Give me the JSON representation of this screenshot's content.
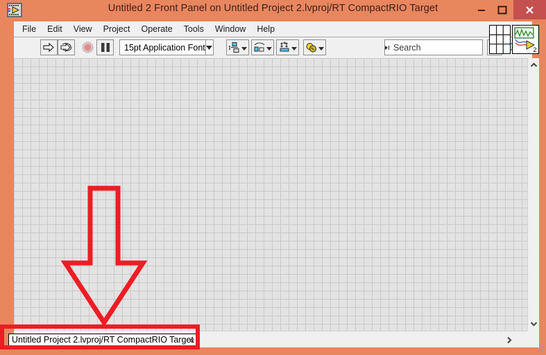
{
  "window": {
    "title": "Untitled 2 Front Panel on Untitled Project 2.lvproj/RT CompactRIO Target",
    "app_icon": "labview-vi-icon",
    "frame_color": "#e8865e",
    "close_button_color": "#c4504f",
    "controls": {
      "minimize": "minimize-icon",
      "maximize": "maximize-icon",
      "close": "close-icon"
    }
  },
  "menubar": {
    "items": [
      {
        "label": "File"
      },
      {
        "label": "Edit"
      },
      {
        "label": "View"
      },
      {
        "label": "Project"
      },
      {
        "label": "Operate"
      },
      {
        "label": "Tools"
      },
      {
        "label": "Window"
      },
      {
        "label": "Help"
      }
    ]
  },
  "toolbar": {
    "run": {
      "name": "run-button",
      "icon": "run-arrow-icon"
    },
    "run_continuously": {
      "name": "run-continuously-button",
      "icon": "run-continuously-icon"
    },
    "abort": {
      "name": "abort-execution-button",
      "icon": "abort-stop-icon"
    },
    "pause": {
      "name": "pause-button",
      "icon": "pause-icon"
    },
    "font_selector": {
      "value": "15pt Application Font",
      "icon": "chevron-down-icon"
    },
    "align_objects": {
      "icon": "align-objects-icon"
    },
    "distribute_objects": {
      "icon": "distribute-objects-icon"
    },
    "resize_objects": {
      "icon": "resize-objects-icon"
    },
    "reorder": {
      "icon": "reorder-icon"
    },
    "search": {
      "placeholder": "Search",
      "value": "",
      "icon": "search-magnifier-icon",
      "pin_icon": "pin-icon"
    },
    "help": {
      "icon": "question-mark-help-icon",
      "label": "?"
    }
  },
  "icon_editor": {
    "connector_pane": "connector-pane-grid",
    "vi_icon": "vi-icon-waveform",
    "vi_icon_number": "2"
  },
  "canvas": {
    "grid_spacing_px": 12,
    "background_color": "#e3e3e3",
    "grid_line_color": "#c9c9c9"
  },
  "statusbar": {
    "target": "Untitled Project 2.lvproj/RT CompactRIO Target",
    "collapse_label": "«"
  },
  "scrollbars": {
    "vertical": {
      "up_icon": "chevron-up-icon",
      "down_icon": "chevron-down-icon"
    },
    "horizontal": {
      "right_icon": "chevron-right-icon"
    },
    "resize_grip": "resize-grip-icon"
  },
  "annotations": {
    "color": "#ee1c23",
    "arrow": {
      "name": "red-down-arrow-annotation",
      "direction": "down",
      "points_to": "statusbar-target-field"
    },
    "highlight_box": {
      "name": "red-highlight-box-annotation",
      "surrounds": "statusbar-target-field"
    }
  }
}
